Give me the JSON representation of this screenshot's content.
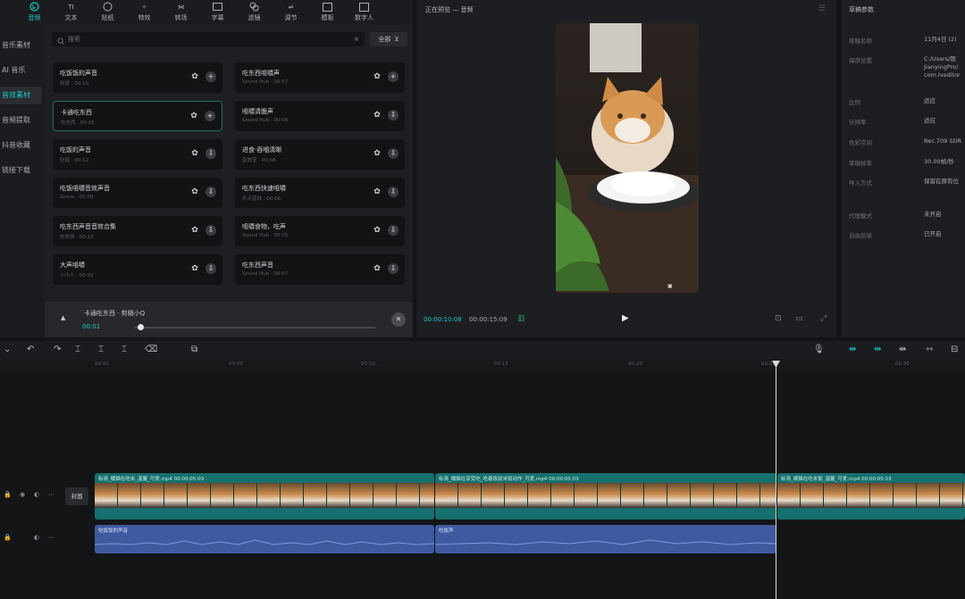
{
  "toolbar": {
    "items": [
      {
        "label": "",
        "icon": "media-icon"
      },
      {
        "label": "音频",
        "icon": "audio-icon",
        "active": true
      },
      {
        "label": "文本",
        "icon": "text-icon"
      },
      {
        "label": "贴纸",
        "icon": "sticker-icon"
      },
      {
        "label": "特效",
        "icon": "effects-icon"
      },
      {
        "label": "转场",
        "icon": "transition-icon"
      },
      {
        "label": "字幕",
        "icon": "caption-icon"
      },
      {
        "label": "滤镜",
        "icon": "filter-icon"
      },
      {
        "label": "调节",
        "icon": "adjust-icon"
      },
      {
        "label": "模板",
        "icon": "template-icon"
      },
      {
        "label": "数字人",
        "icon": "digital-human-icon"
      }
    ]
  },
  "leftnav": {
    "items": [
      {
        "label": "音乐素材"
      },
      {
        "label": "AI 音乐"
      },
      {
        "label": "音效素材",
        "active": true
      },
      {
        "label": "音频提取"
      },
      {
        "label": "抖音收藏"
      },
      {
        "label": "链接下载"
      }
    ]
  },
  "library": {
    "search_placeholder": "搜索",
    "filter_label": "全部",
    "cards": [
      {
        "title": "吃饭饭的声音",
        "sub": "吃饭 · 00:10"
      },
      {
        "title": "卡通吃东西",
        "sub": "吃东西 · 00:05"
      },
      {
        "title": "吃饭的声音",
        "sub": "吃饭 · 00:12"
      },
      {
        "title": "吃饭咀嚼音效声音",
        "sub": "Gloria · 00:09"
      },
      {
        "title": "吃东西声音音效合集",
        "sub": "吃东西 · 00:15"
      },
      {
        "title": "大声咀嚼",
        "sub": "小小人 · 00:02"
      },
      {
        "title": "吃东西咀嚼声",
        "sub": "Sound Hub · 00:07"
      },
      {
        "title": "咀嚼清脆声",
        "sub": "Sound Hub · 00:04"
      },
      {
        "title": "进食·吞咽清晰",
        "sub": "音效宝 · 00:08"
      },
      {
        "title": "吃东西快速咀嚼",
        "sub": "乐点音效 · 00:06"
      },
      {
        "title": "咀嚼食物，吃声",
        "sub": "Sound Hub · 00:05"
      },
      {
        "title": "吃东西声音",
        "sub": "Sound Hub · 00:07"
      }
    ],
    "player": {
      "name": "卡通吃东西 · 剪辑小Q",
      "time": "00:01"
    }
  },
  "preview": {
    "header": "正在预览 — 音频",
    "timecode": "00:00:10:08",
    "total": "00:00:15:09"
  },
  "details": {
    "header": "草稿参数",
    "rows": [
      {
        "k": "草稿名称",
        "v": "11月4日 (2)"
      },
      {
        "k": "保存位置",
        "v": "C:/Users/银\nJianyingPro/\ncom.lveditor"
      },
      {
        "k": "比例",
        "v": "适应"
      },
      {
        "k": "分辨率",
        "v": "适应"
      },
      {
        "k": "色彩空间",
        "v": "Rec.709 SDR"
      },
      {
        "k": "草稿帧率",
        "v": "30.00帧/秒"
      },
      {
        "k": "导入方式",
        "v": "保留在原有位"
      },
      {
        "k": "代理模式",
        "v": "未开启"
      },
      {
        "k": "自由层级",
        "v": "已开启"
      }
    ]
  },
  "timeline": {
    "ticks": [
      "00:00",
      "00:05",
      "00:10",
      "00:15",
      "00:20",
      "00:25",
      "00:30"
    ],
    "cover_label": "封面",
    "video_clips": [
      {
        "label": "标清_橘猫在吃米_温馨_可爱.mp4  00:00:05:03"
      },
      {
        "label": "标清_橘猫在享受吃_吃着饭前米饭动作_可爱.mp4  00:00:05:03"
      },
      {
        "label": "标清_橘猫在吃米饭_温馨_可爱.mp4  00:00:05:03"
      }
    ],
    "audio_clips": [
      {
        "label": "吃饭饭的声音"
      },
      {
        "label": "吃饭声"
      }
    ]
  }
}
